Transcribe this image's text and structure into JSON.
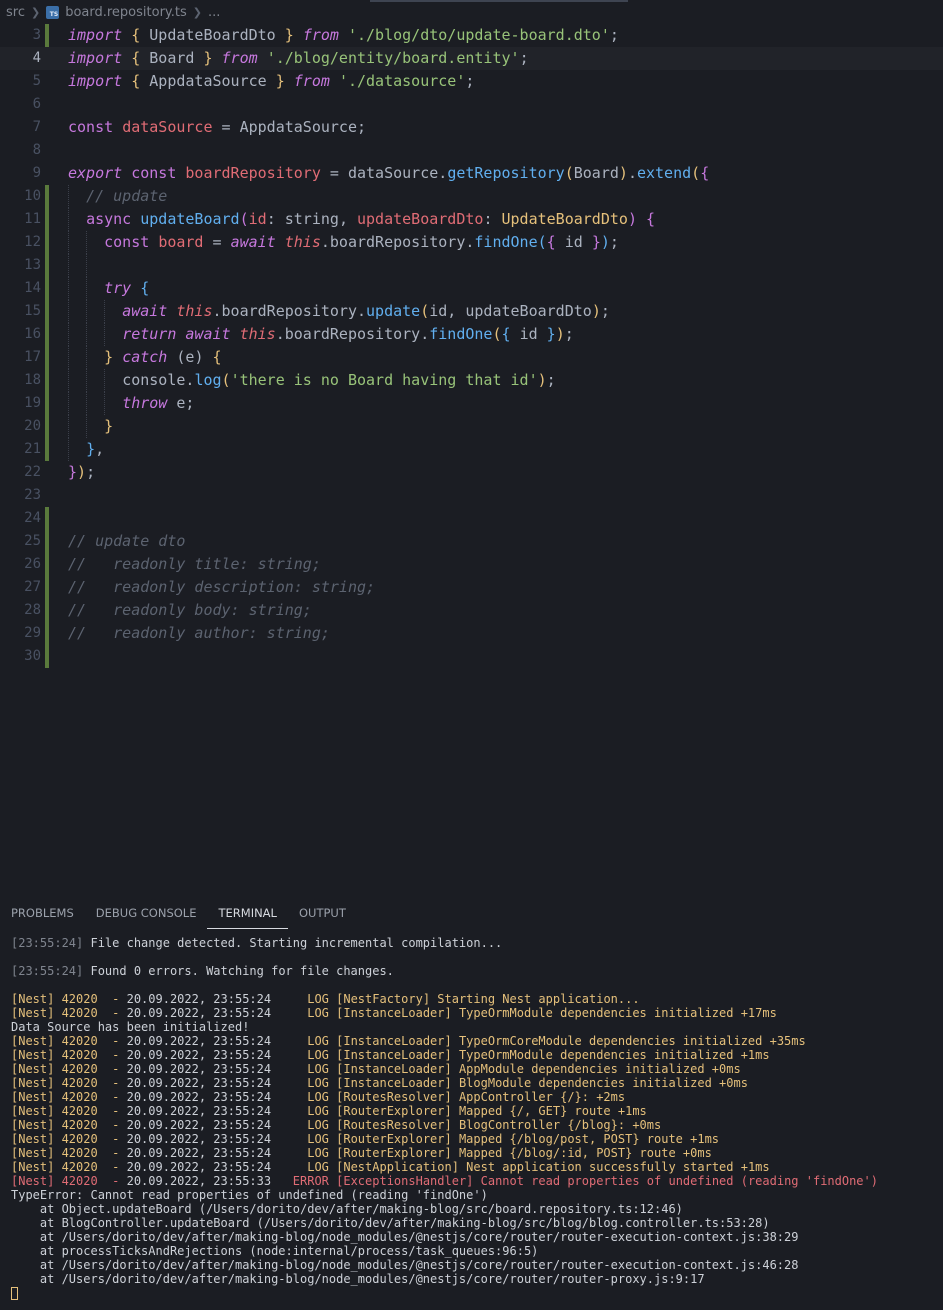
{
  "breadcrumb": {
    "folder": "src",
    "file": "board.repository.ts",
    "more": "...",
    "icon": "typescript-file-icon"
  },
  "editor": {
    "lines": [
      {
        "n": "3",
        "active": false,
        "git": true
      },
      {
        "n": "4",
        "active": true,
        "git": false
      },
      {
        "n": "5",
        "active": false,
        "git": false
      },
      {
        "n": "6",
        "active": false,
        "git": false
      },
      {
        "n": "7",
        "active": false,
        "git": false
      },
      {
        "n": "8",
        "active": false,
        "git": false
      },
      {
        "n": "9",
        "active": false,
        "git": false
      },
      {
        "n": "10",
        "active": false,
        "git": true
      },
      {
        "n": "11",
        "active": false,
        "git": true
      },
      {
        "n": "12",
        "active": false,
        "git": true
      },
      {
        "n": "13",
        "active": false,
        "git": true
      },
      {
        "n": "14",
        "active": false,
        "git": true
      },
      {
        "n": "15",
        "active": false,
        "git": true
      },
      {
        "n": "16",
        "active": false,
        "git": true
      },
      {
        "n": "17",
        "active": false,
        "git": true
      },
      {
        "n": "18",
        "active": false,
        "git": true
      },
      {
        "n": "19",
        "active": false,
        "git": true
      },
      {
        "n": "20",
        "active": false,
        "git": true
      },
      {
        "n": "21",
        "active": false,
        "git": true
      },
      {
        "n": "22",
        "active": false,
        "git": false
      },
      {
        "n": "23",
        "active": false,
        "git": false
      },
      {
        "n": "24",
        "active": false,
        "git": true
      },
      {
        "n": "25",
        "active": false,
        "git": true
      },
      {
        "n": "26",
        "active": false,
        "git": true
      },
      {
        "n": "27",
        "active": false,
        "git": true
      },
      {
        "n": "28",
        "active": false,
        "git": true
      },
      {
        "n": "29",
        "active": false,
        "git": true
      },
      {
        "n": "30",
        "active": false,
        "git": true
      }
    ],
    "code": {
      "l3": [
        "import",
        "{",
        "UpdateBoardDto",
        "}",
        "from",
        "'./blog/dto/update-board.dto'",
        ";"
      ],
      "l4": [
        "import",
        "{",
        "Board",
        "}",
        "from",
        "'./blog/entity/board.entity'",
        ";"
      ],
      "l5": [
        "import",
        "{",
        "AppdataSource",
        "}",
        "from",
        "'./datasource'",
        ";"
      ],
      "l7": [
        "const",
        "dataSource",
        "=",
        "AppdataSource",
        ";"
      ],
      "l9": [
        "export",
        "const",
        "boardRepository",
        "=",
        "dataSource",
        ".",
        "getRepository",
        "(",
        "Board",
        ")",
        ".",
        "extend",
        "(",
        "{"
      ],
      "l10": "// update",
      "l11": [
        "async",
        "updateBoard",
        "(",
        "id",
        ":",
        "string",
        ",",
        "updateBoardDto",
        ":",
        "UpdateBoardDto",
        ")",
        "{"
      ],
      "l12": [
        "const",
        "board",
        "=",
        "await",
        "this",
        ".boardRepository.",
        "findOne",
        "(",
        "{",
        "id",
        "}",
        ")",
        ";"
      ],
      "l14": [
        "try",
        "{"
      ],
      "l15": [
        "await",
        "this",
        ".boardRepository.",
        "update",
        "(",
        "id, updateBoardDto",
        ")",
        ";"
      ],
      "l16": [
        "return",
        "await",
        "this",
        ".boardRepository.",
        "findOne",
        "(",
        "{",
        "id",
        "}",
        ")",
        ";"
      ],
      "l17": [
        "}",
        "catch",
        "(",
        "e",
        ")",
        "{"
      ],
      "l18": [
        "console.",
        "log",
        "(",
        "'there is no Board having that id'",
        ")",
        ";"
      ],
      "l19": [
        "throw",
        "e;"
      ],
      "l20": "}",
      "l21": [
        "}",
        ","
      ],
      "l22": [
        "}",
        ")",
        ";"
      ],
      "l25": "// update dto",
      "l26": "//   readonly title: string;",
      "l27": "//   readonly description: string;",
      "l28": "//   readonly body: string;",
      "l29": "//   readonly author: string;"
    }
  },
  "panel": {
    "tabs": [
      "PROBLEMS",
      "DEBUG CONSOLE",
      "TERMINAL",
      "OUTPUT"
    ],
    "active_tab": "TERMINAL"
  },
  "terminal": {
    "compile": [
      {
        "time": "[23:55:24]",
        "text": " File change detected. Starting incremental compilation..."
      },
      {
        "time": "[23:55:24]",
        "text": " Found 0 errors. Watching for file changes."
      }
    ],
    "logs": [
      {
        "kind": "log",
        "prefix": "[Nest] 42020  - ",
        "date": "20.09.2022, 23:55:24",
        "level": "     LOG ",
        "ctx": "[NestFactory]",
        "msg": " Starting Nest application..."
      },
      {
        "kind": "log",
        "prefix": "[Nest] 42020  - ",
        "date": "20.09.2022, 23:55:24",
        "level": "     LOG ",
        "ctx": "[InstanceLoader]",
        "msg": " TypeOrmModule dependencies initialized +17ms"
      },
      {
        "kind": "plain",
        "text": "Data Source has been initialized!"
      },
      {
        "kind": "log",
        "prefix": "[Nest] 42020  - ",
        "date": "20.09.2022, 23:55:24",
        "level": "     LOG ",
        "ctx": "[InstanceLoader]",
        "msg": " TypeOrmCoreModule dependencies initialized +35ms"
      },
      {
        "kind": "log",
        "prefix": "[Nest] 42020  - ",
        "date": "20.09.2022, 23:55:24",
        "level": "     LOG ",
        "ctx": "[InstanceLoader]",
        "msg": " TypeOrmModule dependencies initialized +1ms"
      },
      {
        "kind": "log",
        "prefix": "[Nest] 42020  - ",
        "date": "20.09.2022, 23:55:24",
        "level": "     LOG ",
        "ctx": "[InstanceLoader]",
        "msg": " AppModule dependencies initialized +0ms"
      },
      {
        "kind": "log",
        "prefix": "[Nest] 42020  - ",
        "date": "20.09.2022, 23:55:24",
        "level": "     LOG ",
        "ctx": "[InstanceLoader]",
        "msg": " BlogModule dependencies initialized +0ms"
      },
      {
        "kind": "log",
        "prefix": "[Nest] 42020  - ",
        "date": "20.09.2022, 23:55:24",
        "level": "     LOG ",
        "ctx": "[RoutesResolver]",
        "msg": " AppController {/}: +2ms"
      },
      {
        "kind": "log",
        "prefix": "[Nest] 42020  - ",
        "date": "20.09.2022, 23:55:24",
        "level": "     LOG ",
        "ctx": "[RouterExplorer]",
        "msg": " Mapped {/, GET} route +1ms"
      },
      {
        "kind": "log",
        "prefix": "[Nest] 42020  - ",
        "date": "20.09.2022, 23:55:24",
        "level": "     LOG ",
        "ctx": "[RoutesResolver]",
        "msg": " BlogController {/blog}: +0ms"
      },
      {
        "kind": "log",
        "prefix": "[Nest] 42020  - ",
        "date": "20.09.2022, 23:55:24",
        "level": "     LOG ",
        "ctx": "[RouterExplorer]",
        "msg": " Mapped {/blog/post, POST} route +1ms"
      },
      {
        "kind": "log",
        "prefix": "[Nest] 42020  - ",
        "date": "20.09.2022, 23:55:24",
        "level": "     LOG ",
        "ctx": "[RouterExplorer]",
        "msg": " Mapped {/blog/:id, POST} route +0ms"
      },
      {
        "kind": "log",
        "prefix": "[Nest] 42020  - ",
        "date": "20.09.2022, 23:55:24",
        "level": "     LOG ",
        "ctx": "[NestApplication]",
        "msg": " Nest application successfully started +1ms"
      },
      {
        "kind": "error",
        "prefix": "[Nest] 42020  - ",
        "date": "20.09.2022, 23:55:33",
        "level": "   ERROR ",
        "ctx": "[ExceptionsHandler]",
        "msg": " Cannot read properties of undefined (reading 'findOne')"
      },
      {
        "kind": "plain",
        "text": "TypeError: Cannot read properties of undefined (reading 'findOne')"
      },
      {
        "kind": "plain",
        "text": "    at Object.updateBoard (/Users/dorito/dev/after/making-blog/src/board.repository.ts:12:46)"
      },
      {
        "kind": "plain",
        "text": "    at BlogController.updateBoard (/Users/dorito/dev/after/making-blog/src/blog/blog.controller.ts:53:28)"
      },
      {
        "kind": "plain",
        "text": "    at /Users/dorito/dev/after/making-blog/node_modules/@nestjs/core/router/router-execution-context.js:38:29"
      },
      {
        "kind": "plain",
        "text": "    at processTicksAndRejections (node:internal/process/task_queues:96:5)"
      },
      {
        "kind": "plain",
        "text": "    at /Users/dorito/dev/after/making-blog/node_modules/@nestjs/core/router/router-execution-context.js:46:28"
      },
      {
        "kind": "plain",
        "text": "    at /Users/dorito/dev/after/making-blog/node_modules/@nestjs/core/router/router-proxy.js:9:17"
      }
    ]
  },
  "colors": {
    "background": "#1b1d23",
    "keyword": "#c678dd",
    "string": "#98c379",
    "function": "#61afef",
    "class": "#e5c07b",
    "variable": "#e06c75",
    "comment": "#5c6370",
    "git_modified": "#5a7a3c"
  }
}
